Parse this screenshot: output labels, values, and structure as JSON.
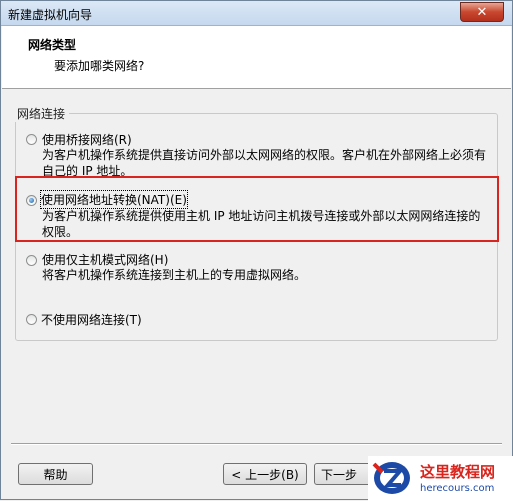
{
  "window": {
    "title": "新建虚拟机向导",
    "close_glyph": "✕"
  },
  "header": {
    "title": "网络类型",
    "subtitle": "要添加哪类网络?"
  },
  "group": {
    "legend": "网络连接",
    "options": [
      {
        "label": "使用桥接网络(R)",
        "desc": "为客户机操作系统提供直接访问外部以太网网络的权限。客户机在外部网络上必须有自己的 IP 地址。",
        "checked": false
      },
      {
        "label": "使用网络地址转换(NAT)(E)",
        "desc": "为客户机操作系统提供使用主机 IP 地址访问主机拨号连接或外部以太网网络连接的权限。",
        "checked": true
      },
      {
        "label": "使用仅主机模式网络(H)",
        "desc": "将客户机操作系统连接到主机上的专用虚拟网络。",
        "checked": false
      },
      {
        "label": "不使用网络连接(T)",
        "desc": "",
        "checked": false
      }
    ]
  },
  "buttons": {
    "help": "帮助",
    "back": "< 上一步(B)",
    "next": "下一步"
  },
  "watermark": {
    "cn": "这里教程网",
    "en": "herecours.com"
  },
  "colors": {
    "highlight": "#d9251d",
    "radio_selected": "#1b5ca8"
  }
}
